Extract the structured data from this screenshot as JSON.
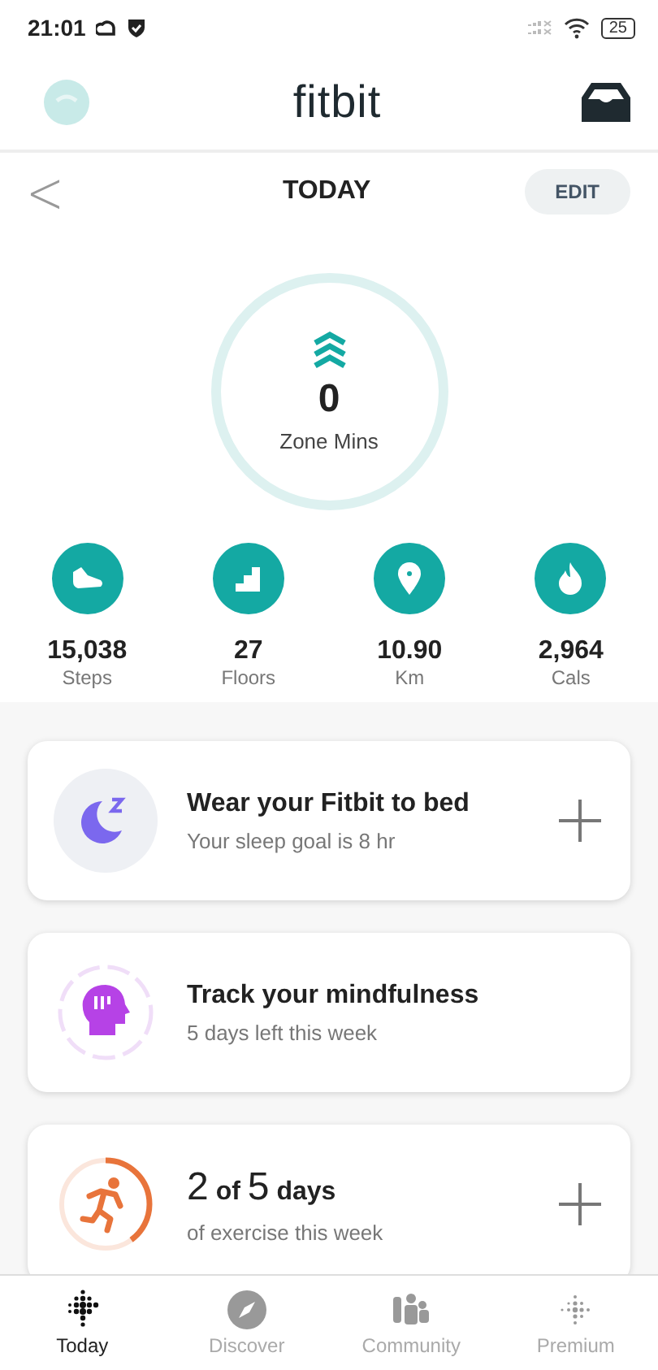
{
  "status_bar": {
    "time": "21:01",
    "battery": "25"
  },
  "header": {
    "title": "fitbit"
  },
  "date_bar": {
    "back": "<",
    "title": "TODAY",
    "edit": "EDIT"
  },
  "zone": {
    "value": "0",
    "label": "Zone Mins"
  },
  "stats": [
    {
      "kind": "steps",
      "value": "15,038",
      "label": "Steps"
    },
    {
      "kind": "floors",
      "value": "27",
      "label": "Floors"
    },
    {
      "kind": "distance",
      "value": "10.90",
      "label": "Km"
    },
    {
      "kind": "calories",
      "value": "2,964",
      "label": "Cals"
    }
  ],
  "cards": [
    {
      "kind": "sleep",
      "title": [
        {
          "text": "Wear your Fitbit to bed",
          "kind": "normal"
        }
      ],
      "subtitle": "Your sleep goal is 8 hr",
      "has_add": true
    },
    {
      "kind": "mindfulness",
      "title": [
        {
          "text": "Track your mindfulness",
          "kind": "normal"
        }
      ],
      "subtitle": "5 days left this week",
      "has_add": false
    },
    {
      "kind": "exercise",
      "level": 0.4,
      "title": [
        {
          "text": "2",
          "kind": "big"
        },
        {
          "text": "of",
          "kind": "small"
        },
        {
          "text": "5",
          "kind": "big"
        },
        {
          "text": "days",
          "kind": "normal"
        }
      ],
      "subtitle": "of exercise this week",
      "has_add": true
    }
  ],
  "nav": [
    {
      "kind": "today",
      "label": "Today",
      "selected": true
    },
    {
      "kind": "discover",
      "label": "Discover",
      "selected": false
    },
    {
      "kind": "community",
      "label": "Community",
      "selected": false
    },
    {
      "kind": "premium",
      "label": "Premium",
      "selected": false
    }
  ]
}
